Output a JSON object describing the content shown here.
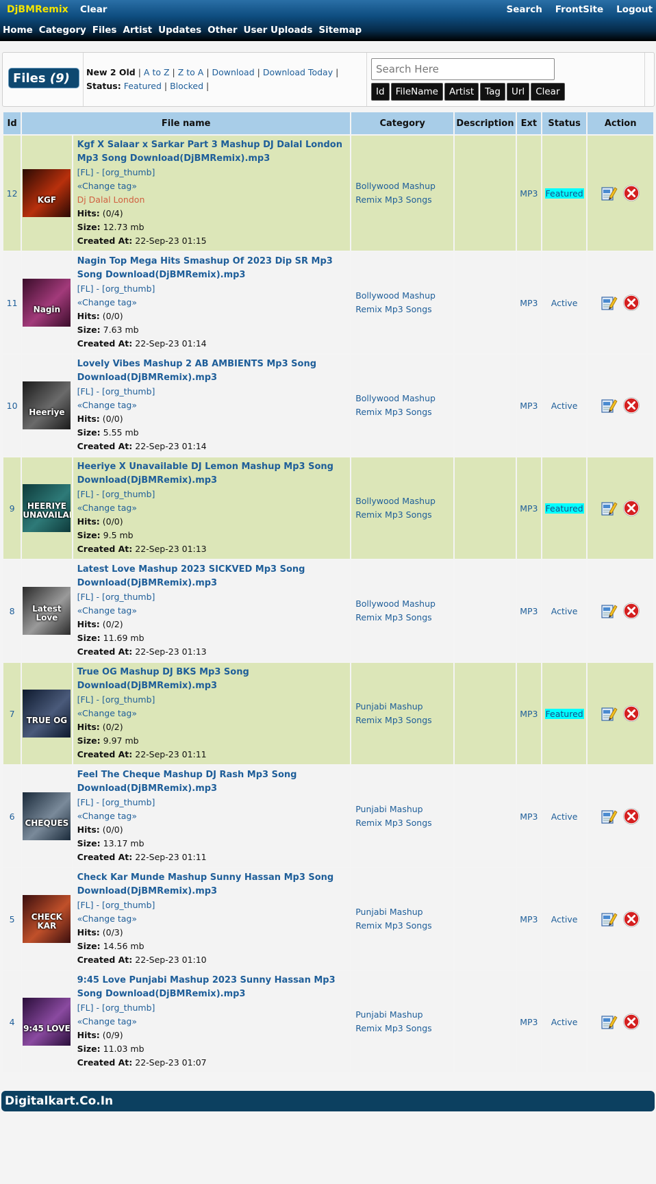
{
  "header": {
    "brand": "DjBMRemix",
    "clear": "Clear",
    "right_links": [
      "Search",
      "FrontSite",
      "Logout"
    ],
    "nav": [
      "Home",
      "Category",
      "Files",
      "Artist",
      "Updates",
      "Other",
      "User Uploads",
      "Sitemap"
    ]
  },
  "panel": {
    "files_label": "Files",
    "files_count": "(9)",
    "sort_current": "New 2 Old",
    "sort_links": [
      "A to Z",
      "Z to A",
      "Download",
      "Download Today"
    ],
    "status_label": "Status:",
    "status_links": [
      "Featured",
      "Blocked"
    ],
    "search_placeholder": "Search Here",
    "buttons": [
      "Id",
      "FileName",
      "Artist",
      "Tag",
      "Url",
      "Clear"
    ]
  },
  "table": {
    "headers": [
      "Id",
      "File name",
      "Category",
      "Description",
      "Ext",
      "Status",
      "Action"
    ],
    "labels": {
      "hits": "Hits:",
      "size": "Size:",
      "created": "Created At:",
      "fl": "[FL]",
      "thumb": "[org_thumb]",
      "change_tag": "«Change tag»",
      "dash": "-"
    },
    "rows": [
      {
        "id": "12",
        "name": "Kgf X Salaar x Sarkar Part 3 Mashup DJ Dalal London Mp3 Song Download(DjBMRemix).mp3",
        "artist": "Dj Dalal London",
        "hits": "(0/4)",
        "size": "12.73 mb",
        "created": "22-Sep-23 01:15",
        "category": "Bollywood Mashup Remix Mp3 Songs",
        "ext": "MP3",
        "status": "Featured",
        "thumb_text": "KGF",
        "thumb_colors": [
          "#2a0a04",
          "#b8300c"
        ]
      },
      {
        "id": "11",
        "name": "Nagin Top Mega Hits Smashup Of 2023 Dip SR Mp3 Song Download(DjBMRemix).mp3",
        "artist": "",
        "hits": "(0/0)",
        "size": "7.63 mb",
        "created": "22-Sep-23 01:14",
        "category": "Bollywood Mashup Remix Mp3 Songs",
        "ext": "MP3",
        "status": "Active",
        "thumb_text": "Nagin",
        "thumb_colors": [
          "#3a0d2a",
          "#a23a7a"
        ]
      },
      {
        "id": "10",
        "name": "Lovely Vibes Mashup 2 AB AMBIENTS Mp3 Song Download(DjBMRemix).mp3",
        "artist": "",
        "hits": "(0/0)",
        "size": "5.55 mb",
        "created": "22-Sep-23 01:14",
        "category": "Bollywood Mashup Remix Mp3 Songs",
        "ext": "MP3",
        "status": "Active",
        "thumb_text": "Heeriye",
        "thumb_colors": [
          "#1a1a1a",
          "#6a6a6a"
        ]
      },
      {
        "id": "9",
        "name": "Heeriye X Unavailable DJ Lemon Mashup Mp3 Song Download(DjBMRemix).mp3",
        "artist": "",
        "hits": "(0/0)",
        "size": "9.5 mb",
        "created": "22-Sep-23 01:13",
        "category": "Bollywood Mashup Remix Mp3 Songs",
        "ext": "MP3",
        "status": "Featured",
        "thumb_text": "HEERIYE UNAVAILABLE",
        "thumb_colors": [
          "#0e3a3a",
          "#2e7a78"
        ]
      },
      {
        "id": "8",
        "name": "Latest Love Mashup 2023 SICKVED Mp3 Song Download(DjBMRemix).mp3",
        "artist": "",
        "hits": "(0/2)",
        "size": "11.69 mb",
        "created": "22-Sep-23 01:13",
        "category": "Bollywood Mashup Remix Mp3 Songs",
        "ext": "MP3",
        "status": "Active",
        "thumb_text": "Latest Love",
        "thumb_colors": [
          "#2a2a2a",
          "#9a9a9a"
        ]
      },
      {
        "id": "7",
        "name": "True OG Mashup DJ BKS Mp3 Song Download(DjBMRemix).mp3",
        "artist": "",
        "hits": "(0/2)",
        "size": "9.97 mb",
        "created": "22-Sep-23 01:11",
        "category": "Punjabi Mashup Remix Mp3 Songs",
        "ext": "MP3",
        "status": "Featured",
        "thumb_text": "TRUE OG",
        "thumb_colors": [
          "#0e1a2e",
          "#4a5a7a"
        ]
      },
      {
        "id": "6",
        "name": "Feel The Cheque Mashup DJ Rash Mp3 Song Download(DjBMRemix).mp3",
        "artist": "",
        "hits": "(0/0)",
        "size": "13.17 mb",
        "created": "22-Sep-23 01:11",
        "category": "Punjabi Mashup Remix Mp3 Songs",
        "ext": "MP3",
        "status": "Active",
        "thumb_text": "CHEQUES",
        "thumb_colors": [
          "#1a2a3a",
          "#7a8a9a"
        ]
      },
      {
        "id": "5",
        "name": "Check Kar Munde Mashup Sunny Hassan Mp3 Song Download(DjBMRemix).mp3",
        "artist": "",
        "hits": "(0/3)",
        "size": "14.56 mb",
        "created": "22-Sep-23 01:10",
        "category": "Punjabi Mashup Remix Mp3 Songs",
        "ext": "MP3",
        "status": "Active",
        "thumb_text": "CHECK KAR",
        "thumb_colors": [
          "#3a0e0e",
          "#c0502a"
        ]
      },
      {
        "id": "4",
        "name": "9:45 Love Punjabi Mashup 2023 Sunny Hassan Mp3 Song Download(DjBMRemix).mp3",
        "artist": "",
        "hits": "(0/9)",
        "size": "11.03 mb",
        "created": "22-Sep-23 01:07",
        "category": "Punjabi Mashup Remix Mp3 Songs",
        "ext": "MP3",
        "status": "Active",
        "thumb_text": "9:45 LOVE",
        "thumb_colors": [
          "#2a0e3a",
          "#8a4aa0"
        ]
      }
    ]
  },
  "footer": {
    "text": "Digitalkart.Co.In"
  }
}
